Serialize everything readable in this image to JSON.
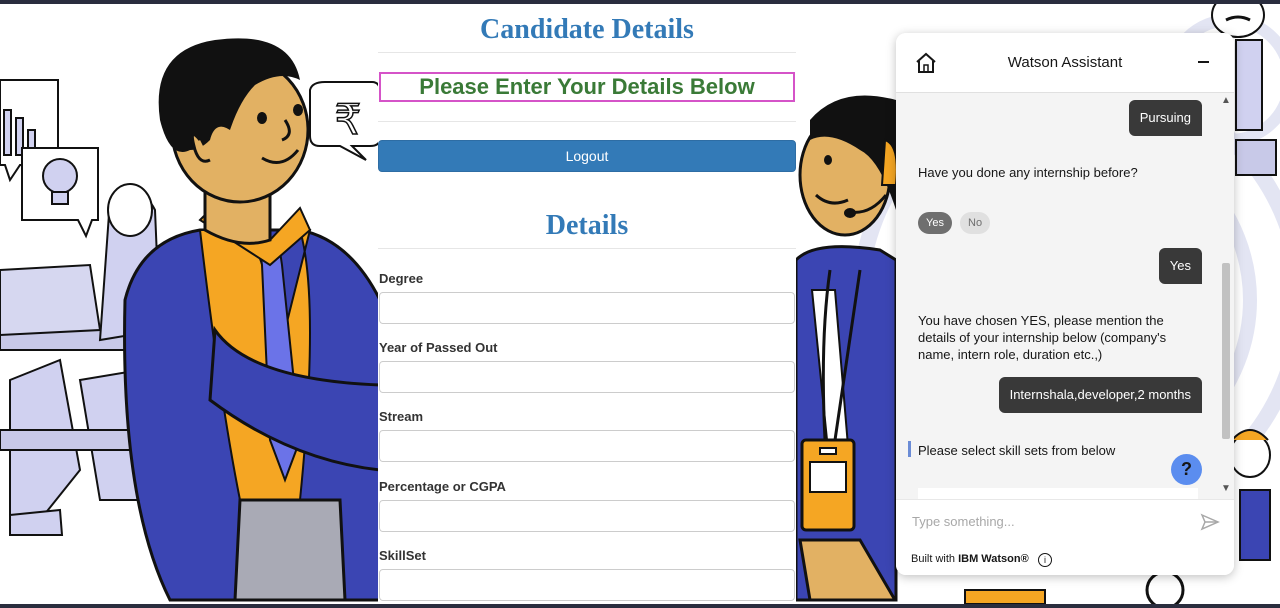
{
  "form": {
    "candidate_title": "Candidate Details",
    "enter_prompt": "Please Enter Your Details Below",
    "logout_label": "Logout",
    "details_title": "Details",
    "fields": [
      {
        "label": "Degree",
        "value": ""
      },
      {
        "label": "Year of Passed Out",
        "value": ""
      },
      {
        "label": "Stream",
        "value": ""
      },
      {
        "label": "Percentage or CGPA",
        "value": ""
      },
      {
        "label": "SkillSet",
        "value": ""
      }
    ]
  },
  "background": {
    "rupee_symbol": "₹"
  },
  "watson": {
    "title": "Watson Assistant",
    "messages": {
      "user_pursuing": "Pursuing",
      "bot_internship_question": "Have you done any internship before?",
      "option_yes": "Yes",
      "option_no": "No",
      "user_yes": "Yes",
      "bot_chosen_yes": "You have chosen YES, please mention the details of your internship below (company's name, intern role, duration etc.,)",
      "user_internship": "Internshala,developer,2 months",
      "bot_skill_select": "Please select skill sets from below"
    },
    "help_label": "?",
    "input_placeholder": "Type something...",
    "footer_prefix": "Built with ",
    "footer_brand": "IBM Watson®",
    "info_label": "i"
  }
}
